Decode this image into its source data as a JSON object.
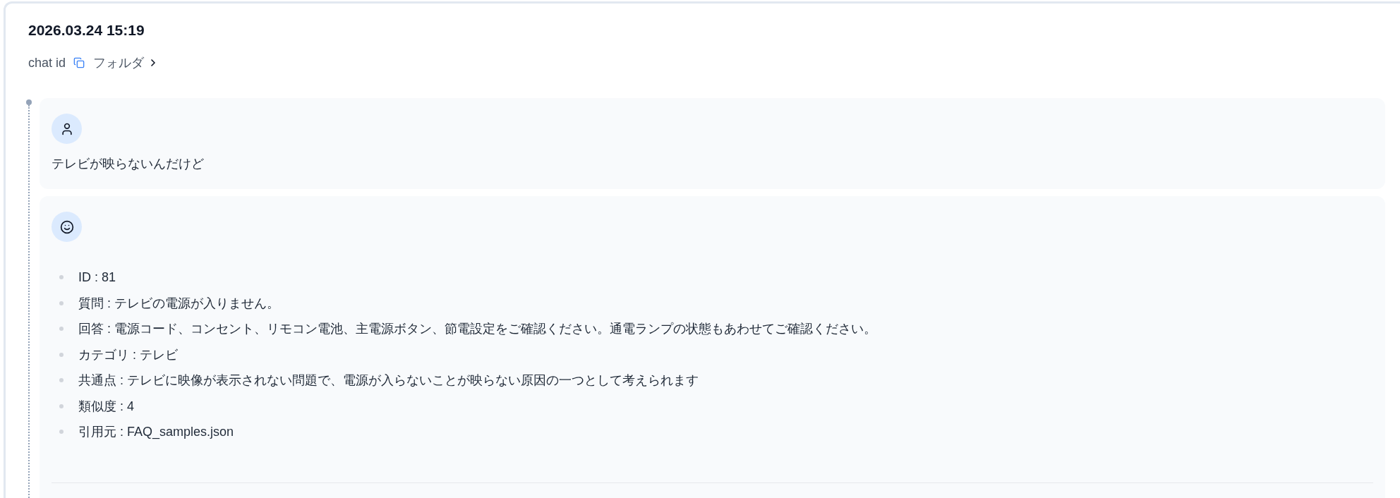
{
  "header": {
    "timestamp": "2026.03.24 15:19",
    "chat_id_label": "chat id",
    "folder_link": "フォルダ"
  },
  "messages": [
    {
      "kind": "user",
      "text": "テレビが映らないんだけど"
    },
    {
      "kind": "assistant",
      "items": [
        "ID : 81",
        "質問 : テレビの電源が入りません。",
        "回答 : 電源コード、コンセント、リモコン電池、主電源ボタン、節電設定をご確認ください。通電ランプの状態もあわせてご確認ください。",
        "カテゴリ : テレビ",
        "共通点 : テレビに映像が表示されない問題で、電源が入らないことが映らない原因の一つとして考えられます",
        "類似度 : 4",
        "引用元 : FAQ_samples.json"
      ]
    }
  ]
}
